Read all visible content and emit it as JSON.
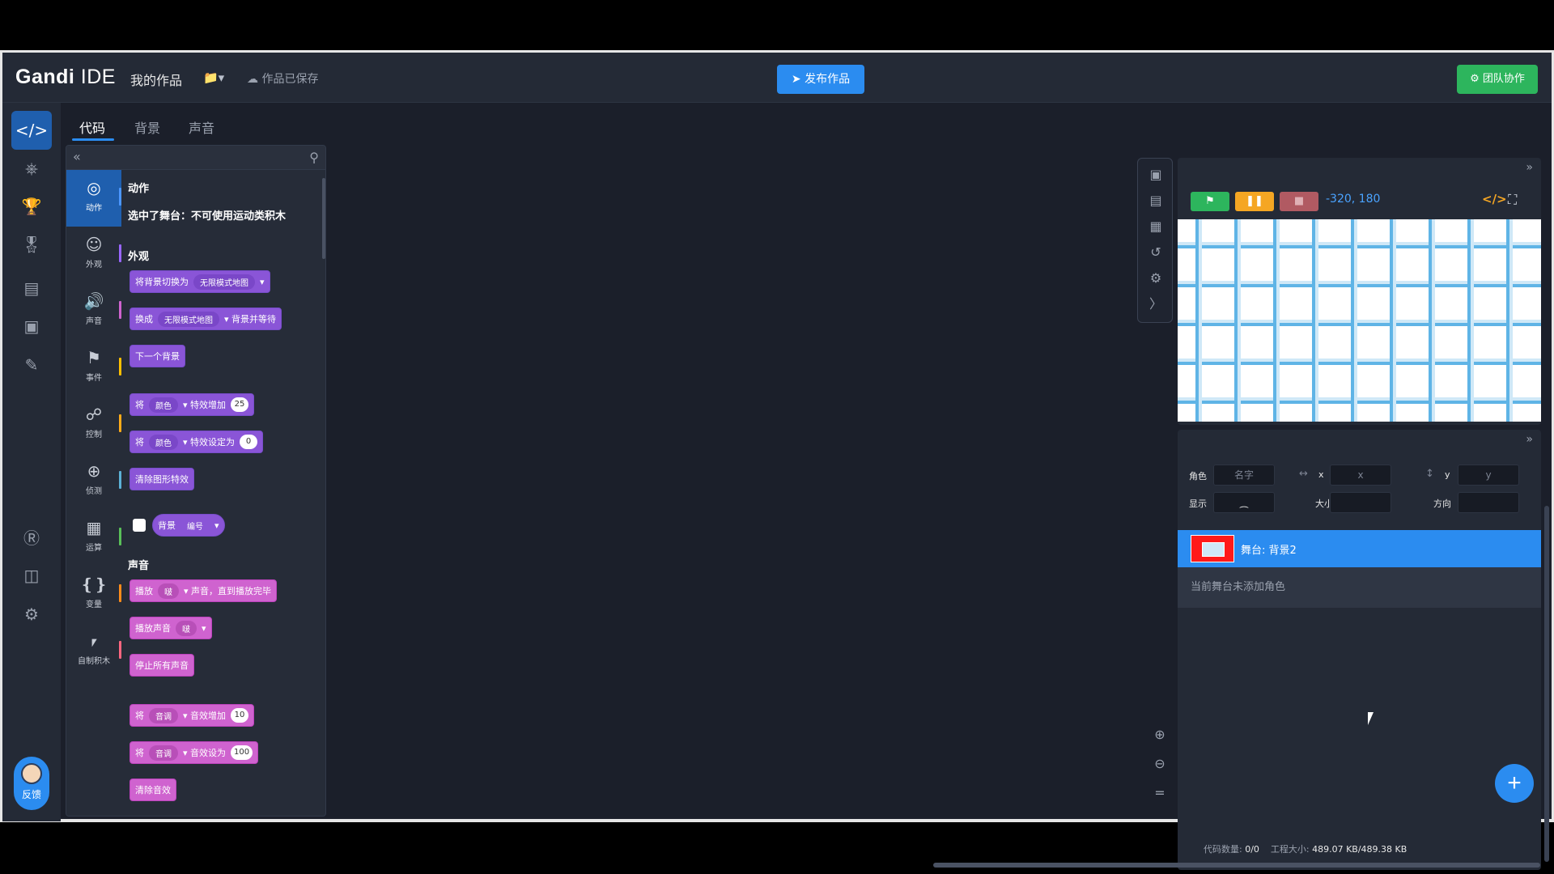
{
  "header": {
    "logo_bold": "Gandi",
    "logo_light": " IDE",
    "my_works": "我的作品",
    "folder_icon": "folder-icon",
    "saved_status": "作品已保存",
    "publish_label": "发布作品",
    "team_label": "团队协作"
  },
  "editor_tabs": [
    "代码",
    "背景",
    "声音"
  ],
  "palette": {
    "categories": [
      "动作",
      "外观",
      "声音",
      "事件",
      "控制",
      "侦测",
      "运算",
      "变量",
      "自制积木"
    ],
    "category_colors": [
      "#4c97ff",
      "#9966ff",
      "#cf63cf",
      "#ffbf00",
      "#ffab19",
      "#5cb1d6",
      "#59c059",
      "#ff8c1a",
      "#ff6680"
    ],
    "motion_heading": "动作",
    "motion_note": "选中了舞台：不可使用运动类积木",
    "looks_heading": "外观",
    "looks_blocks": {
      "switch_backdrop": "将背景切换为",
      "switch_backdrop_menu": "无限模式地图",
      "switch_and_wait_prefix": "换成",
      "switch_and_wait_menu": "无限模式地图",
      "switch_and_wait_suffix": "背景并等待",
      "next_backdrop": "下一个背景",
      "change_effect_prefix": "将",
      "change_effect_menu": "颜色",
      "change_effect_suffix": "特效增加",
      "change_effect_value": "25",
      "set_effect_prefix": "将",
      "set_effect_menu": "颜色",
      "set_effect_suffix": "特效设定为",
      "set_effect_value": "0",
      "clear_effects": "清除图形特效",
      "backdrop_reporter": "背景",
      "backdrop_reporter_menu": "编号"
    },
    "sound_heading": "声音",
    "sound_blocks": {
      "play_until_prefix": "播放",
      "play_until_menu": "啵",
      "play_until_suffix": "声音，直到播放完毕",
      "start_sound": "播放声音",
      "start_sound_menu": "啵",
      "stop_all": "停止所有声音",
      "change_pitch_prefix": "将",
      "change_pitch_menu": "音调",
      "change_pitch_suffix": "音效增加",
      "change_pitch_value": "10",
      "set_pitch_prefix": "将",
      "set_pitch_menu": "音调",
      "set_pitch_suffix": "音效设为",
      "set_pitch_value": "100",
      "clear_sound": "清除音效"
    }
  },
  "stage_controls": {
    "coords": "-320,  180"
  },
  "sprite_info": {
    "sprite_label": "角色",
    "name_placeholder": "名字",
    "x_label": "x",
    "x_placeholder": "x",
    "y_label": "y",
    "y_placeholder": "y",
    "show_label": "显示",
    "size_label": "大小",
    "direction_label": "方向"
  },
  "stage_item": {
    "name": "舞台: 背景2"
  },
  "no_sprite_text": "当前舞台未添加角色",
  "footer": {
    "code_count_label": "代码数量: ",
    "code_count_value": "0/0",
    "project_size_label": "工程大小: ",
    "project_size_value": "489.07 KB/489.38 KB"
  },
  "feedback_label": "反馈",
  "colors": {
    "accent_blue": "#2b8cf0",
    "team_green": "#2db55d",
    "looks_purple": "#8a55d7",
    "sound_pink": "#cf63cf"
  }
}
